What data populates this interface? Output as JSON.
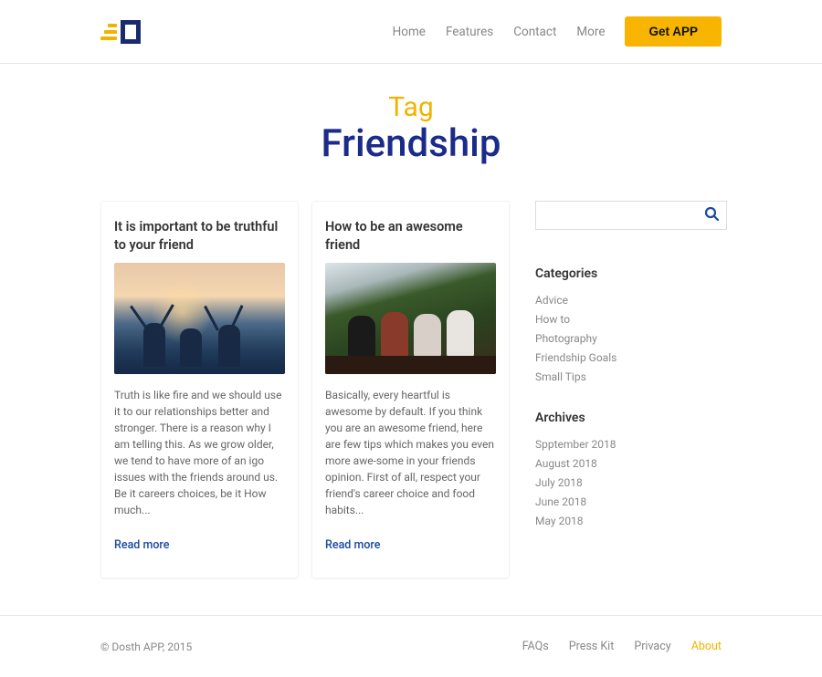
{
  "nav": {
    "home": "Home",
    "features": "Features",
    "contact": "Contact",
    "more": "More",
    "getapp": "Get APP"
  },
  "hero": {
    "tag": "Tag",
    "title": "Friendship"
  },
  "posts": [
    {
      "title": "It is important to be truthful to your friend",
      "excerpt": "Truth is like fire and we should use it to our relationships better and stronger. There is a reason why I am telling this. As we grow older, we tend to have more of an  igo issues with the friends around us. Be it careers choices, be it How much...",
      "readmore": "Read more"
    },
    {
      "title": "How to be an awesome friend",
      "excerpt": "Basically, every heartful is awesome by default. If you think you are an awesome friend, here are few tips which makes you even more awe-some in your friends opinion. First of all, respect your friend's career choice and food habits...",
      "readmore": "Read more"
    }
  ],
  "sidebar": {
    "categories_title": "Categories",
    "categories": [
      "Advice",
      "How to",
      "Photography",
      "Friendship Goals",
      "Small Tips"
    ],
    "archives_title": "Archives",
    "archives": [
      "Spptember 2018",
      "August 2018",
      "July 2018",
      "June 2018",
      "May 2018"
    ]
  },
  "footer": {
    "copyright": "© Dosth APP, 2015",
    "links": {
      "faqs": "FAQs",
      "press": "Press Kit",
      "privacy": "Privacy",
      "about": "About"
    }
  }
}
